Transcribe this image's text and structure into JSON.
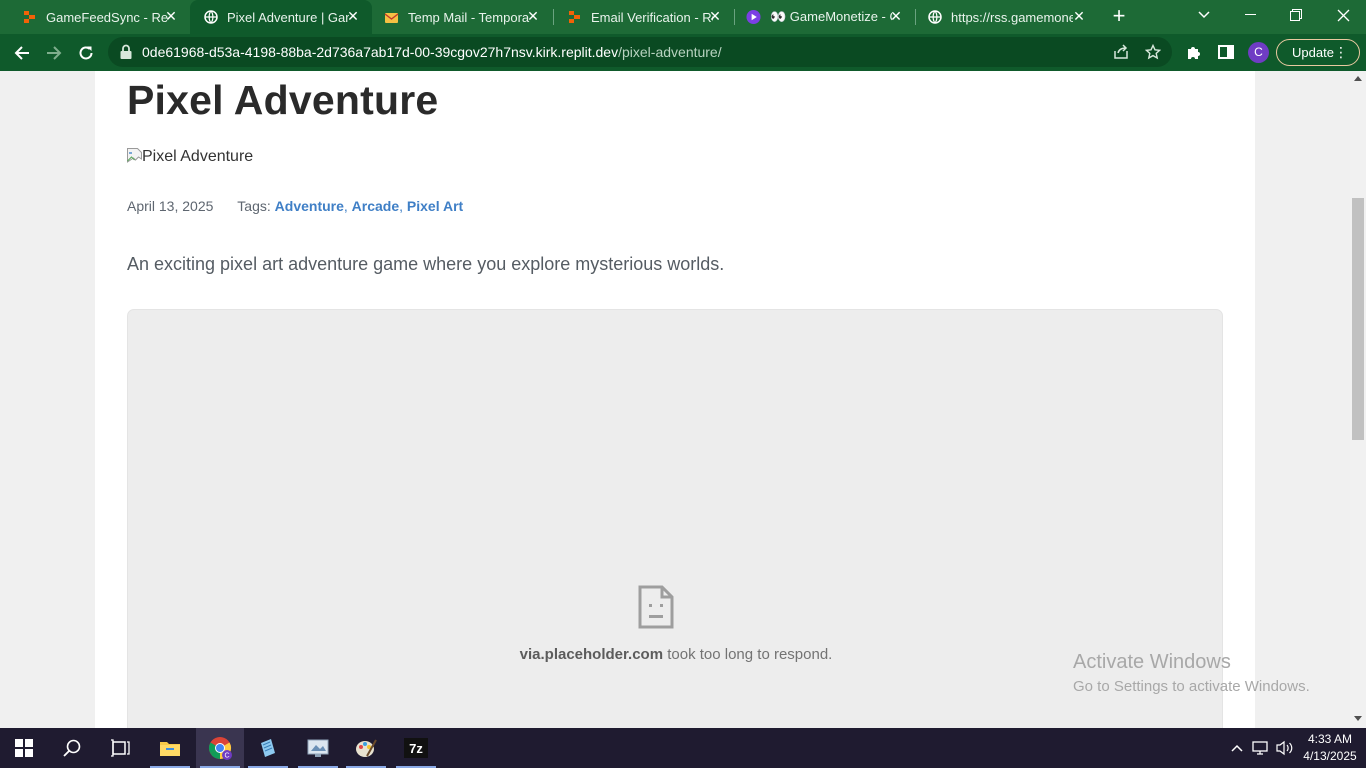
{
  "browser": {
    "tabs": [
      {
        "title": "GameFeedSync - Repli",
        "favicon": "replit-icon",
        "active": false
      },
      {
        "title": "Pixel Adventure | Gam",
        "favicon": "globe-icon",
        "active": true
      },
      {
        "title": "Temp Mail - Temporar",
        "favicon": "mail-icon",
        "active": false
      },
      {
        "title": "Email Verification - Re",
        "favicon": "replit-icon",
        "active": false
      },
      {
        "title": "👀 GameMonetize - G",
        "favicon": "gamemonetize-icon",
        "active": false
      },
      {
        "title": "https://rss.gamemone",
        "favicon": "globe-icon",
        "active": false
      }
    ],
    "url_host": "0de61968-d53a-4198-88ba-2d736a7ab17d-00-39cgov27h7nsv.kirk.replit.dev",
    "url_path": "/pixel-adventure/",
    "profile_initial": "C",
    "update_label": "Update"
  },
  "page": {
    "title": "Pixel Adventure",
    "image_alt": "Pixel Adventure",
    "date": "April 13, 2025",
    "tags_label": "Tags:",
    "tags": [
      "Adventure",
      "Arcade",
      "Pixel Art"
    ],
    "description": "An exciting pixel art adventure game where you explore mysterious worlds.",
    "embed_error": {
      "host": "via.placeholder.com",
      "message": " took too long to respond."
    }
  },
  "watermark": {
    "line1": "Activate Windows",
    "line2": "Go to Settings to activate Windows."
  },
  "taskbar": {
    "apps": [
      "windows-start-icon",
      "search-icon",
      "task-view-icon",
      "file-explorer-icon",
      "chrome-icon",
      "notepad-icon",
      "screenshot-tool-icon",
      "paint-icon",
      "7zip-icon"
    ],
    "time": "4:33 AM",
    "date": "4/13/2025"
  },
  "colors": {
    "chrome_frame": "#1d6a36",
    "toolbar": "#0f5a2b",
    "link": "#3f7fc6",
    "taskbar": "#1f1b30"
  }
}
